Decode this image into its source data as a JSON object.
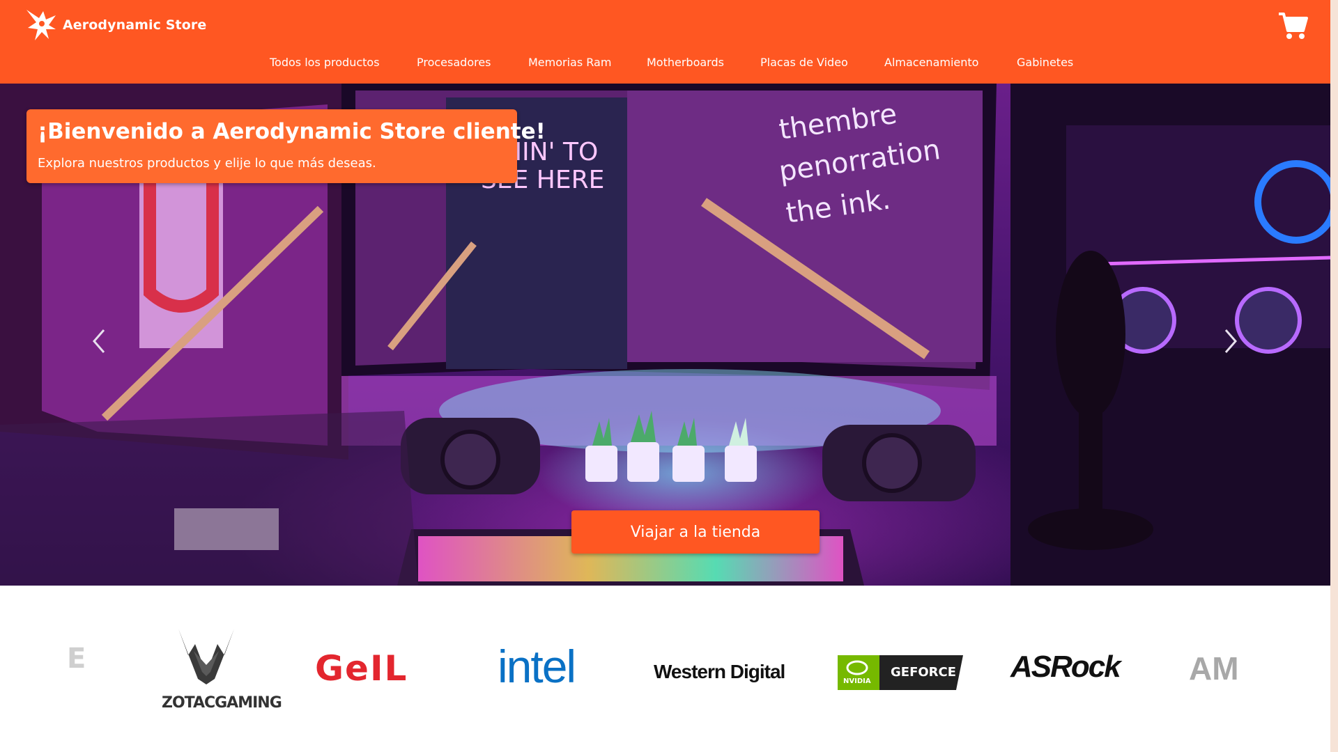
{
  "header": {
    "brand_name": "Aerodynamic Store",
    "logo_icon": "bird-logo-icon",
    "cart_icon": "shopping-cart-icon",
    "nav": [
      {
        "label": "Todos los productos"
      },
      {
        "label": "Procesadores"
      },
      {
        "label": "Memorias Ram"
      },
      {
        "label": "Motherboards"
      },
      {
        "label": "Placas de Video"
      },
      {
        "label": "Almacenamiento"
      },
      {
        "label": "Gabinetes"
      }
    ]
  },
  "hero": {
    "title": "¡Bienvenido a Aerodynamic Store cliente!",
    "subtitle": "Explora nuestros productos y elije lo que más deseas.",
    "cta_label": "Viajar a la tienda",
    "prev_icon": "chevron-left-icon",
    "next_icon": "chevron-right-icon"
  },
  "brands": {
    "items": [
      {
        "name": "ZOTAC GAMING",
        "text": "ZOTACGAMING"
      },
      {
        "name": "GeIL",
        "text": "GeIL"
      },
      {
        "name": "intel",
        "text": "intel"
      },
      {
        "name": "Western Digital",
        "text": "Western Digital"
      },
      {
        "name": "NVIDIA GEFORCE",
        "text": "GEFORCE",
        "badge": "NVIDIA"
      },
      {
        "name": "ASRock",
        "text": "ASRock"
      },
      {
        "name": "AMD",
        "text": "AM"
      }
    ]
  },
  "colors": {
    "primary": "#ff5722",
    "welcome_box": "#ff6a2e",
    "geil_red": "#e3262e",
    "intel_blue": "#0a71c5",
    "nvidia_green": "#76b900"
  }
}
